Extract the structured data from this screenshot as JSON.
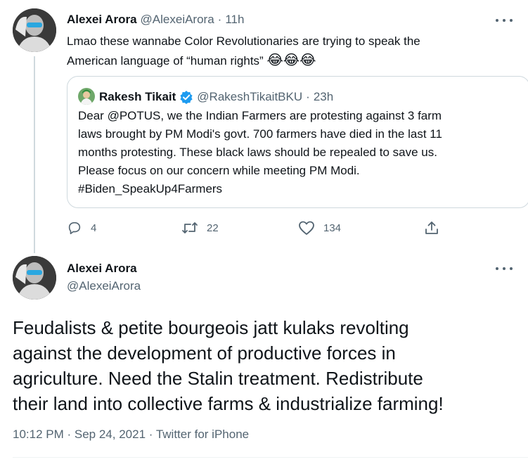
{
  "reply_tweet": {
    "author_name": "Alexei Arora",
    "author_handle": "@AlexeiArora",
    "separator": "·",
    "time": "11h",
    "text_line1": "Lmao these wannabe Color Revolutionaries are trying to speak the",
    "text_line2": "American language of “human rights”",
    "emojis": "😂😂😂",
    "quoted": {
      "author_name": "Rakesh Tikait",
      "author_handle": "@RakeshTikaitBKU",
      "separator": "·",
      "time": "23h",
      "lines": [
        "Dear @POTUS, we the Indian Farmers are protesting against 3 farm",
        "laws brought by PM Modi's govt. 700 farmers have died in the last 11",
        "months protesting. These black laws should be repealed to save us.",
        "Please focus on our concern while meeting PM Modi.",
        "#Biden_SpeakUp4Farmers"
      ]
    },
    "actions": {
      "replies": "4",
      "retweets": "22",
      "likes": "134"
    }
  },
  "main_tweet": {
    "author_name": "Alexei Arora",
    "author_handle": "@AlexeiArora",
    "lines": [
      "Feudalists & petite bourgeois jatt kulaks revolting",
      "against the development of productive forces in",
      "agriculture. Need the Stalin treatment. Redistribute",
      "their land into collective farms & industrialize farming!"
    ],
    "timestamp": "10:12 PM · Sep 24, 2021 · Twitter for iPhone"
  },
  "colors": {
    "text": "#0f1419",
    "muted": "#536471",
    "border": "#cfd9de",
    "verified": "#1d9bf0"
  }
}
